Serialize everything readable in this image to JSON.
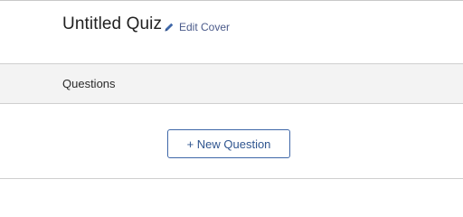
{
  "cover": {
    "title": "Untitled Quiz",
    "edit_label": "Edit Cover",
    "edit_icon": "pencil-icon"
  },
  "questions_section": {
    "label": "Questions"
  },
  "actions": {
    "new_question_label": "+ New Question"
  },
  "colors": {
    "accent": "#3f67a8",
    "link": "#4a5a8a",
    "section_bg": "#f3f3f3"
  }
}
